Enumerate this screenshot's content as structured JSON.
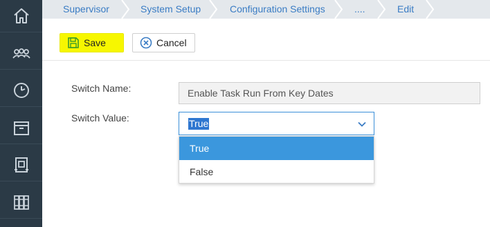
{
  "sidebar": {
    "items": [
      {
        "icon": "home-icon"
      },
      {
        "icon": "users-icon"
      },
      {
        "icon": "dashboard-icon"
      },
      {
        "icon": "archive-icon"
      },
      {
        "icon": "document-icon"
      },
      {
        "icon": "library-icon"
      }
    ]
  },
  "breadcrumb": [
    "Supervisor",
    "System Setup",
    "Configuration Settings",
    "....",
    "Edit"
  ],
  "toolbar": {
    "save_label": "Save",
    "cancel_label": "Cancel",
    "save_highlight_color": "#f7f700"
  },
  "form": {
    "switch_name_label": "Switch Name:",
    "switch_name_value": "Enable Task Run From Key Dates",
    "switch_value_label": "Switch Value:",
    "switch_value_selected": "True",
    "options": [
      "True",
      "False"
    ]
  },
  "colors": {
    "sidebar_bg": "#2b3a46",
    "link": "#3a7cc4",
    "accent": "#3b97dd"
  }
}
